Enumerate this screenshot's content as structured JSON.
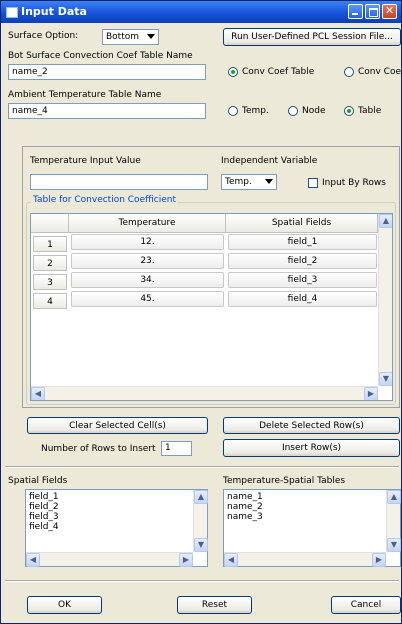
{
  "window": {
    "title": "Input Data"
  },
  "surface": {
    "label": "Surface Option:",
    "value": "Bottom",
    "run_button": "Run User-Defined PCL Session File..."
  },
  "conv_table": {
    "label": "Bot Surface Convection Coef Table Name",
    "value": "name_2",
    "radio_a": "Conv Coef Table",
    "radio_b": "Conv Coef"
  },
  "ambient": {
    "label": "Ambient Temperature Table Name",
    "value": "name_4",
    "radio_temp": "Temp.",
    "radio_node": "Node",
    "radio_table": "Table"
  },
  "temp_input": {
    "label": "Temperature Input Value",
    "value": ""
  },
  "indep_var": {
    "label": "Independent Variable",
    "value": "Temp.",
    "checkbox": "Input By Rows"
  },
  "table": {
    "title": "Table for Convection Coefficient",
    "columns": [
      "Temperature",
      "Spatial Fields"
    ],
    "rows": [
      {
        "num": "1",
        "temp": "12.",
        "field": "field_1"
      },
      {
        "num": "2",
        "temp": "23.",
        "field": "field_2"
      },
      {
        "num": "3",
        "temp": "34.",
        "field": "field_3"
      },
      {
        "num": "4",
        "temp": "45.",
        "field": "field_4"
      }
    ]
  },
  "actions": {
    "clear": "Clear Selected Cell(s)",
    "delete": "Delete Selected Row(s)",
    "rows_label": "Number of Rows to Insert",
    "rows_value": "1",
    "insert": "Insert Row(s)"
  },
  "spatial": {
    "label": "Spatial Fields",
    "items": [
      "field_1",
      "field_2",
      "field_3",
      "field_4"
    ]
  },
  "temp_spatial": {
    "label": "Temperature-Spatial Tables",
    "items": [
      "name_1",
      "name_2",
      "name_3"
    ]
  },
  "footer": {
    "ok": "OK",
    "reset": "Reset",
    "cancel": "Cancel"
  }
}
